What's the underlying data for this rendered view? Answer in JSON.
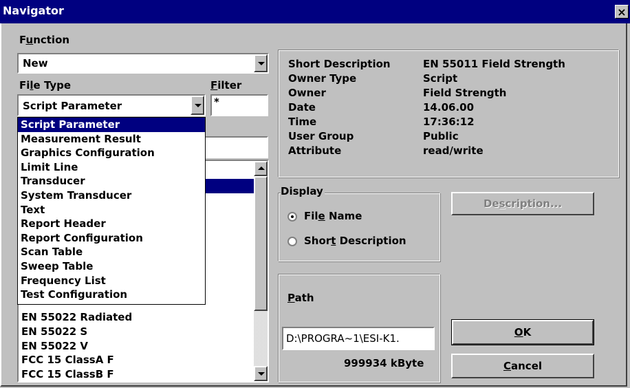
{
  "window": {
    "title": "Navigator",
    "close_label": "×"
  },
  "function": {
    "label": "Function",
    "value": "New"
  },
  "file_type": {
    "label": "File Type",
    "value": "Script Parameter",
    "options": [
      "Script Parameter",
      "Measurement Result",
      "Graphics Configuration",
      "Limit Line",
      "Transducer",
      "System Transducer",
      "Text",
      "Report Header",
      "Report Configuration",
      "Scan Table",
      "Sweep Table",
      "Frequency List",
      "Test Configuration"
    ],
    "selected_index": 0
  },
  "filter": {
    "label": "Filter",
    "value": "*"
  },
  "file_list": {
    "items": [
      "EN 55022 Radiated",
      "EN 55022 S",
      "EN 55022 V",
      "FCC 15 ClassA F",
      "FCC 15 ClassB F"
    ]
  },
  "info": {
    "rows": [
      {
        "label": "Short Description",
        "value": "EN 55011 Field Strength"
      },
      {
        "label": "Owner Type",
        "value": "Script"
      },
      {
        "label": "Owner",
        "value": "Field Strength"
      },
      {
        "label": "Date",
        "value": "14.06.00"
      },
      {
        "label": "Time",
        "value": "17:36:12"
      },
      {
        "label": "User Group",
        "value": "Public"
      },
      {
        "label": "Attribute",
        "value": "read/write"
      }
    ]
  },
  "display": {
    "label": "Display",
    "options": [
      "File Name",
      "Short Description"
    ],
    "selected": "File Name"
  },
  "path": {
    "label": "Path",
    "value": "D:\\PROGRA~1\\ESI-K1.",
    "free_space": "999934 kByte"
  },
  "buttons": {
    "description": "Description...",
    "ok": "OK",
    "cancel": "Cancel"
  }
}
